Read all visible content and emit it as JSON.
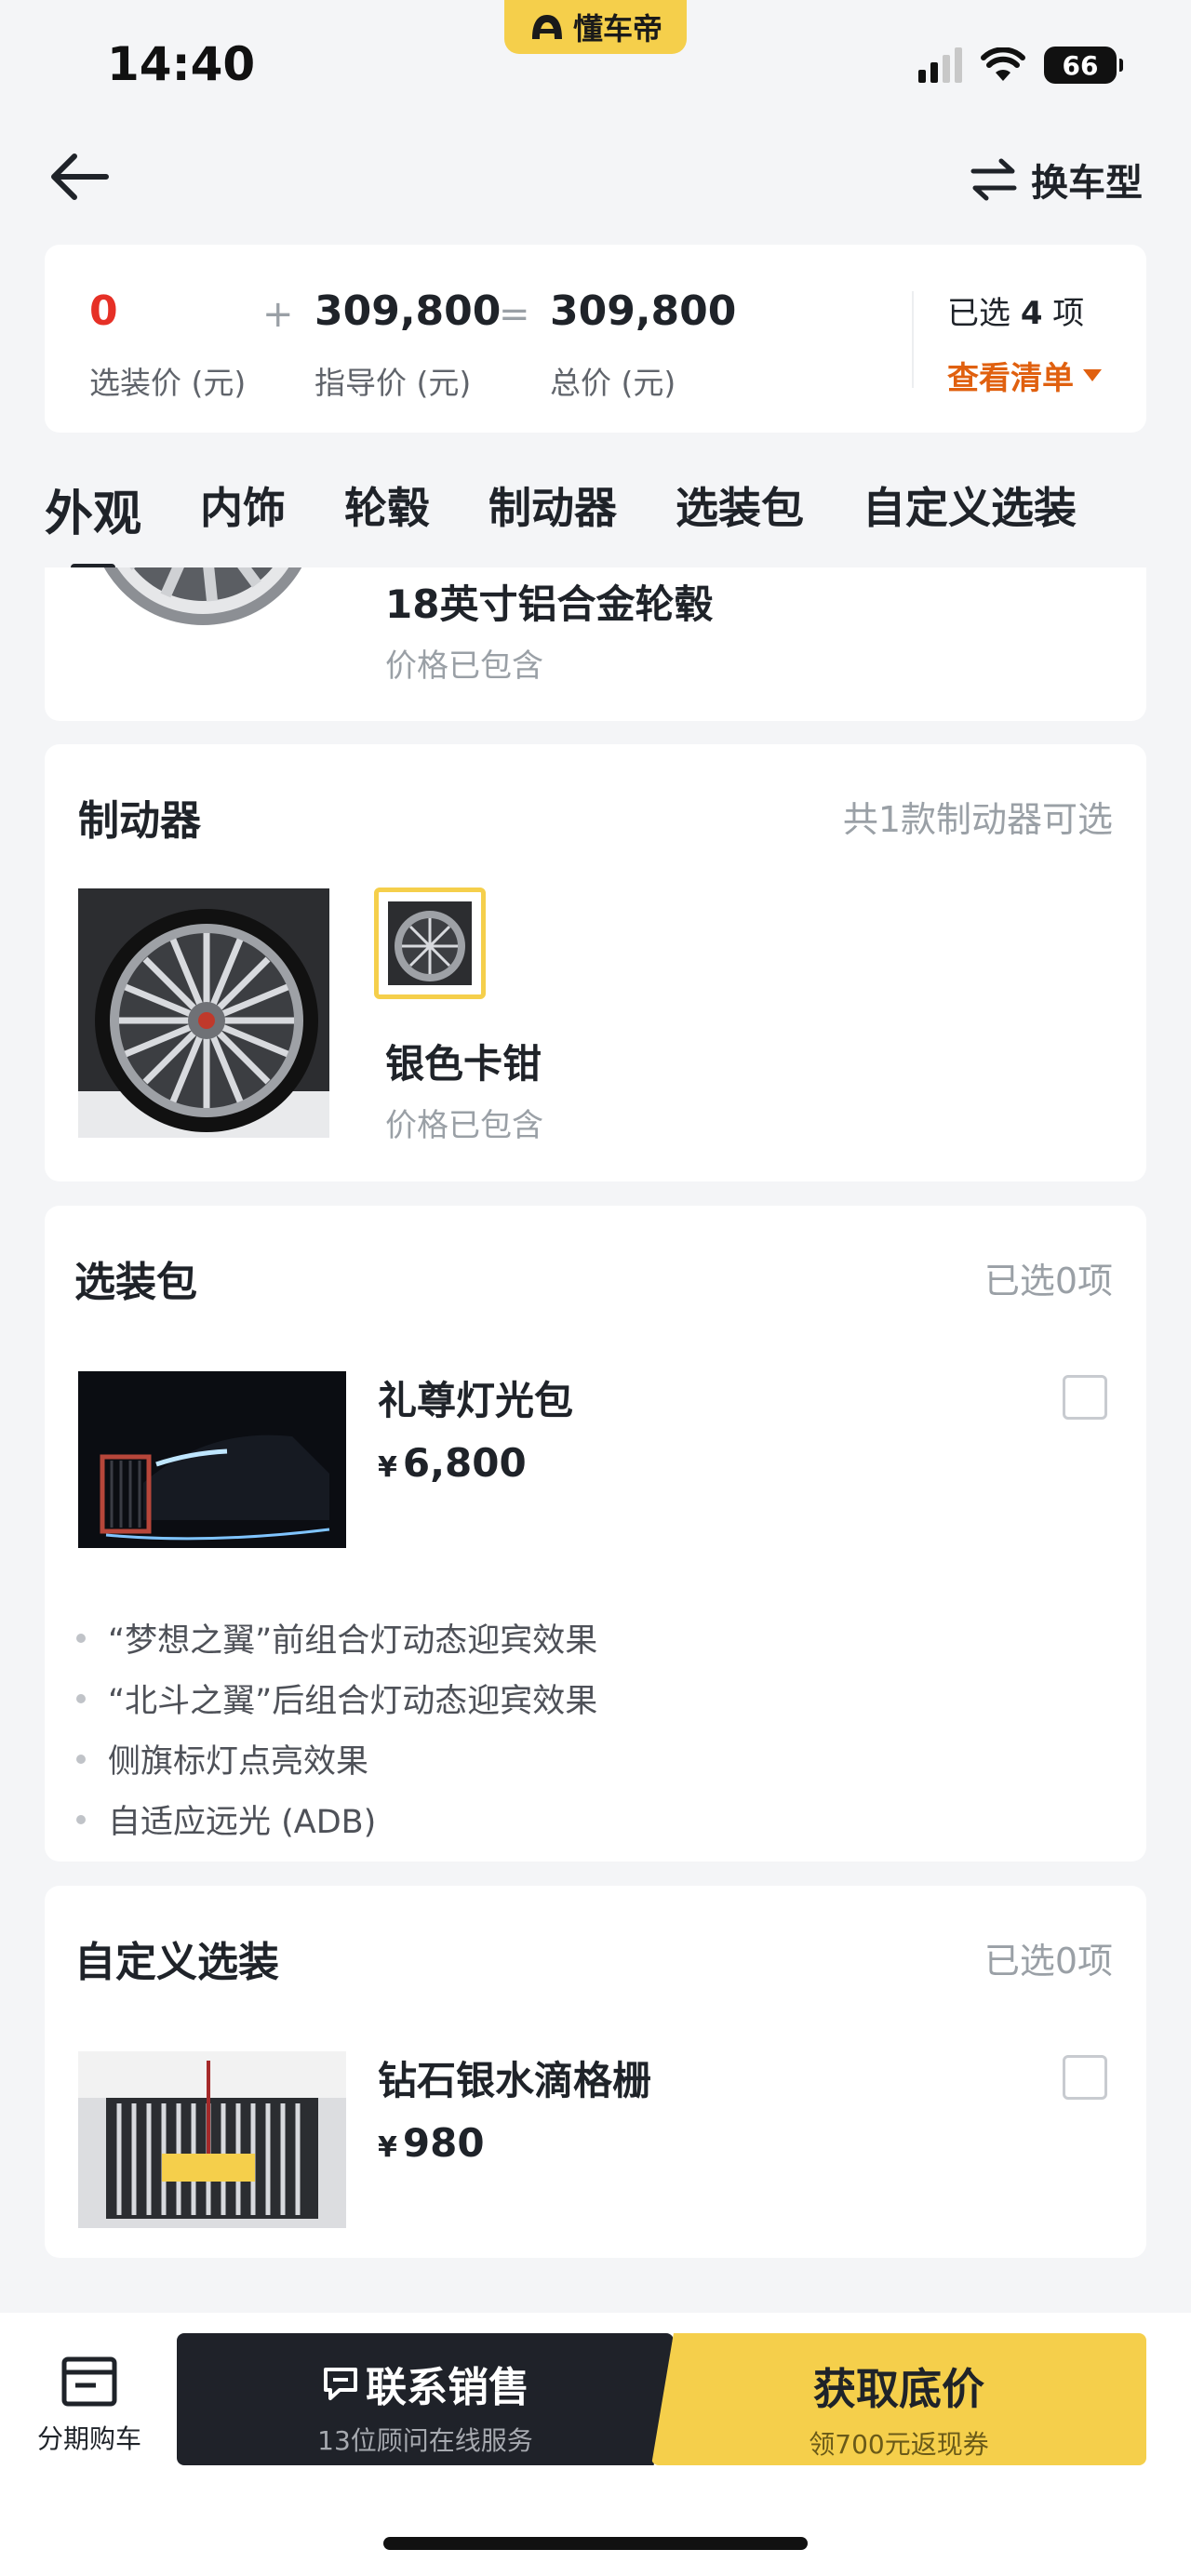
{
  "status_bar": {
    "time": "14:40",
    "app_name": "懂车帝",
    "battery": "66"
  },
  "nav": {
    "switch_label": "换车型"
  },
  "price_summary": {
    "option_price": "0",
    "option_label": "选装价 (元)",
    "plus": "+",
    "equals": "=",
    "guide_price": "309,800",
    "guide_label": "指导价 (元)",
    "total_price": "309,800",
    "total_label": "总价 (元)",
    "selected_prefix": "已选",
    "selected_count": "4",
    "selected_suffix": "项",
    "view_list": "查看清单"
  },
  "tabs": [
    "外观",
    "内饰",
    "轮毂",
    "制动器",
    "选装包",
    "自定义选装"
  ],
  "wheel_card": {
    "name": "18英寸铝合金轮毂",
    "status": "价格已包含"
  },
  "brake_card": {
    "title": "制动器",
    "meta": "共1款制动器可选",
    "option_name": "银色卡钳",
    "option_status": "价格已包含"
  },
  "package_card": {
    "title": "选装包",
    "meta": "已选0项",
    "item": {
      "name": "礼尊灯光包",
      "currency": "¥",
      "price": "6,800"
    },
    "features": [
      "“梦想之翼”前组合灯动态迎宾效果",
      "“北斗之翼”后组合灯动态迎宾效果",
      "侧旗标灯点亮效果",
      "自适应远光 (ADB)"
    ]
  },
  "custom_card": {
    "title": "自定义选装",
    "meta": "已选0项",
    "item": {
      "name": "钻石银水滴格栅",
      "currency": "¥",
      "price": "980"
    }
  },
  "bottom_bar": {
    "installment": "分期购车",
    "contact_main": "联系销售",
    "contact_sub": "13位顾问在线服务",
    "quote_main": "获取底价",
    "quote_sub": "领700元返现券"
  },
  "colors": {
    "accent_yellow": "#f5cf4b",
    "price_red": "#e63026",
    "link_orange": "#e0600f",
    "dark_button": "#1f2229"
  }
}
